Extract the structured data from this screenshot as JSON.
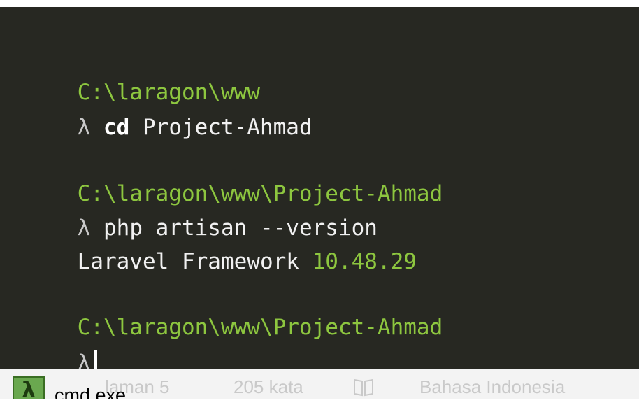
{
  "terminal": {
    "lines": [
      {
        "path": "C:\\laragon\\www"
      },
      {
        "prompt": "λ",
        "cmd": "cd",
        "args": " Project-Ahmad"
      },
      {
        "path": "C:\\laragon\\www\\Project-Ahmad"
      },
      {
        "prompt": "λ",
        "cmd": "php artisan --version"
      },
      {
        "output": "Laravel Framework ",
        "version": "10.48.29"
      },
      {
        "path": "C:\\laragon\\www\\Project-Ahmad"
      },
      {
        "prompt": "λ"
      }
    ]
  },
  "taskbar": {
    "app_label": "cmd.exe",
    "app_icon": "λ"
  },
  "statusbar": {
    "page_fragment": "laman 5",
    "word_count": "205 kata",
    "language": "Bahasa Indonesia"
  },
  "colors": {
    "terminal_bg": "#272822",
    "path_green": "#8dc63f",
    "text_white": "#f8f8f2"
  }
}
